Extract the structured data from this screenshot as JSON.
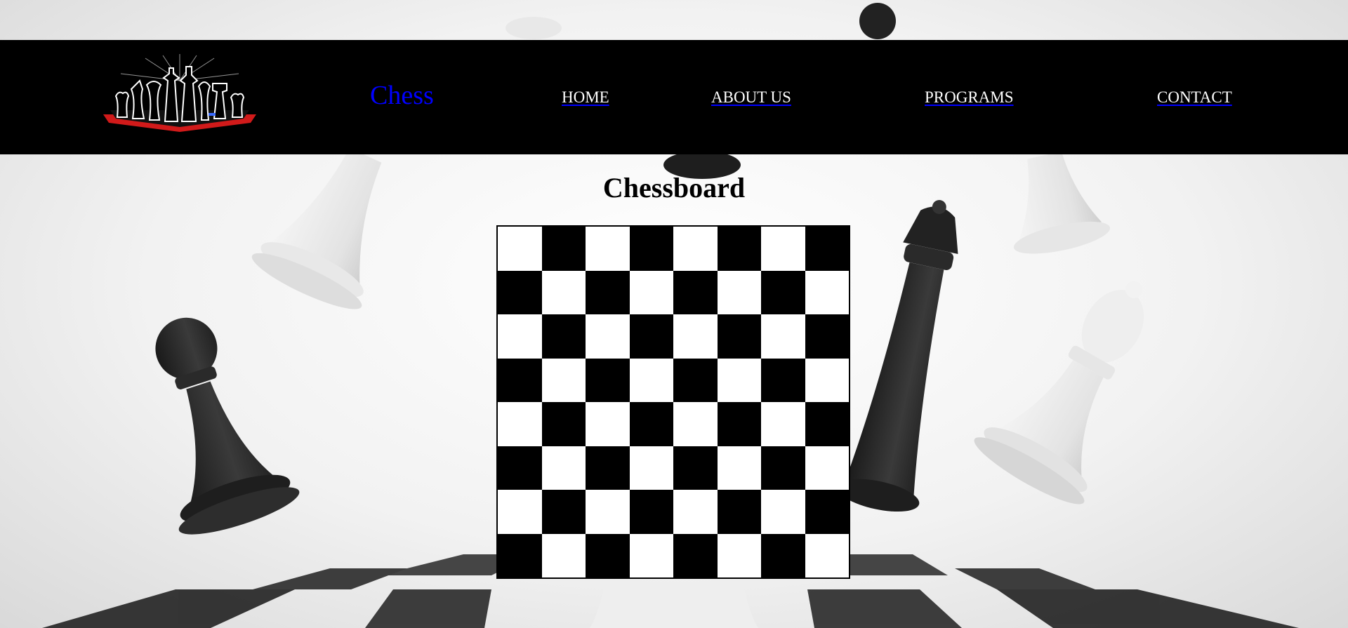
{
  "nav": {
    "brand": "Chess",
    "links": [
      {
        "label": "HOME"
      },
      {
        "label": "ABOUT US"
      },
      {
        "label": "PROGRAMS"
      },
      {
        "label": "CONTACT"
      }
    ]
  },
  "main": {
    "title": "Chessboard",
    "board": {
      "rows": 8,
      "cols": 8,
      "top_left": "light"
    }
  },
  "colors": {
    "navbar_bg": "#000000",
    "brand_link": "#0000ff",
    "nav_text": "#ffffff",
    "dark_square": "#000000",
    "light_square": "#ffffff"
  },
  "icons": {
    "logo": "chess-pieces-logo-icon",
    "background": "chess-pieces-background-image"
  }
}
